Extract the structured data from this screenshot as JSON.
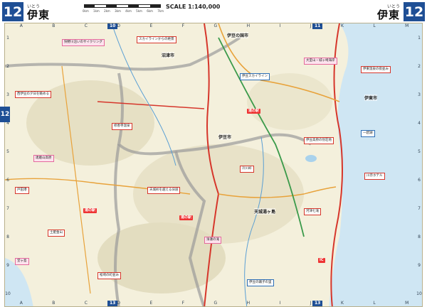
{
  "header": {
    "page_number": "12",
    "place_ruby": "いとう",
    "place_name": "伊東",
    "scale_label": "SCALE 1:140,000",
    "scale_ticks": [
      "0km",
      "1km",
      "2km",
      "3km",
      "4km",
      "5km",
      "6km",
      "7km"
    ]
  },
  "grid": {
    "columns": [
      "A",
      "B",
      "C",
      "D",
      "E",
      "F",
      "G",
      "H",
      "I",
      "J",
      "K",
      "L",
      "M"
    ],
    "rows": [
      "1",
      "2",
      "3",
      "4",
      "5",
      "6",
      "7",
      "8",
      "9",
      "10"
    ]
  },
  "page_refs": {
    "top_left": "10",
    "top_right": "11",
    "bottom_left": "13",
    "bottom_right": "13"
  },
  "side_tabs": [
    "12"
  ],
  "places": [
    {
      "name": "沼津市"
    },
    {
      "name": "伊豆の国市"
    },
    {
      "name": "伊東市"
    },
    {
      "name": "伊豆市"
    },
    {
      "name": "天城湯ヶ島"
    }
  ],
  "annotations": [
    {
      "text": "狩野川沿いのサイクリング",
      "style": "pk"
    },
    {
      "text": "スカイラインからの絶景",
      "style": ""
    },
    {
      "text": "西伊豆の夕日を眺める",
      "style": ""
    },
    {
      "text": "伊豆スカイライン",
      "style": "bl"
    },
    {
      "text": "修善寺温泉",
      "style": ""
    },
    {
      "text": "大室山・城ヶ崎海岸",
      "style": "pk"
    },
    {
      "text": "伊東温泉の街並み",
      "style": ""
    },
    {
      "text": "天城峠を越える旧道",
      "style": ""
    },
    {
      "text": "浄蓮の滝",
      "style": "pk"
    },
    {
      "text": "河津七滝",
      "style": ""
    },
    {
      "text": "伊豆高原の別荘地",
      "style": ""
    },
    {
      "text": "一碧湖",
      "style": "bl"
    },
    {
      "text": "冷川峠",
      "style": ""
    },
    {
      "text": "達磨山高原",
      "style": "pk"
    },
    {
      "text": "戸田港",
      "style": ""
    },
    {
      "text": "土肥金山",
      "style": ""
    },
    {
      "text": "堂ヶ島",
      "style": "pk"
    },
    {
      "text": "松崎の町並み",
      "style": ""
    },
    {
      "text": "川奈ホテル",
      "style": ""
    },
    {
      "text": "伊豆の踊子の里",
      "style": "bl"
    }
  ],
  "badges": [
    "道の駅",
    "道の駅",
    "道の駅",
    "IC"
  ]
}
